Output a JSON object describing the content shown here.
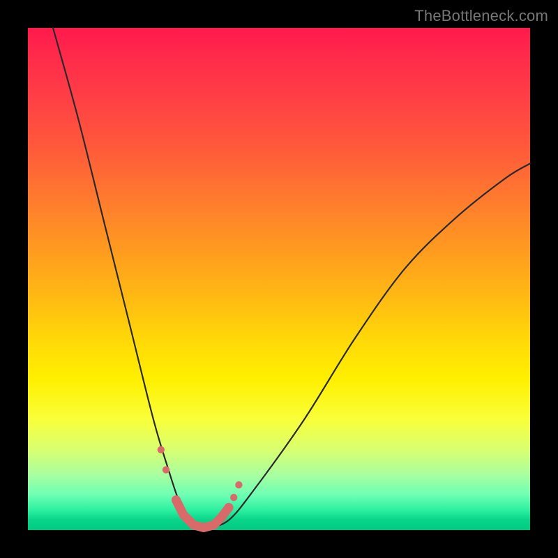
{
  "watermark": "TheBottleneck.com",
  "chart_data": {
    "type": "line",
    "title": "",
    "xlabel": "",
    "ylabel": "",
    "xlim": [
      0,
      100
    ],
    "ylim": [
      0,
      100
    ],
    "grid": false,
    "legend": false,
    "background_gradient": {
      "top": "#ff1a4d",
      "bottom": "#02c982",
      "description": "red-to-green vertical gradient (worse at top, better at bottom)"
    },
    "series": [
      {
        "name": "bottleneck-curve",
        "x": [
          5,
          10,
          15,
          20,
          25,
          28,
          30,
          32,
          34,
          36,
          40,
          45,
          55,
          65,
          75,
          85,
          95,
          100
        ],
        "y": [
          100,
          82,
          62,
          42,
          22,
          12,
          6,
          2,
          0.5,
          0.5,
          2,
          8,
          22,
          38,
          52,
          62,
          70,
          73
        ]
      }
    ],
    "highlight_points": {
      "name": "optimal-zone-markers",
      "color": "#d96a6a",
      "x": [
        26.5,
        27.5,
        29.5,
        31,
        33,
        35,
        37,
        38.5,
        40,
        41,
        42
      ],
      "y": [
        16,
        12,
        6,
        3,
        1,
        0.5,
        1,
        2.5,
        4.5,
        6.5,
        9
      ]
    }
  }
}
